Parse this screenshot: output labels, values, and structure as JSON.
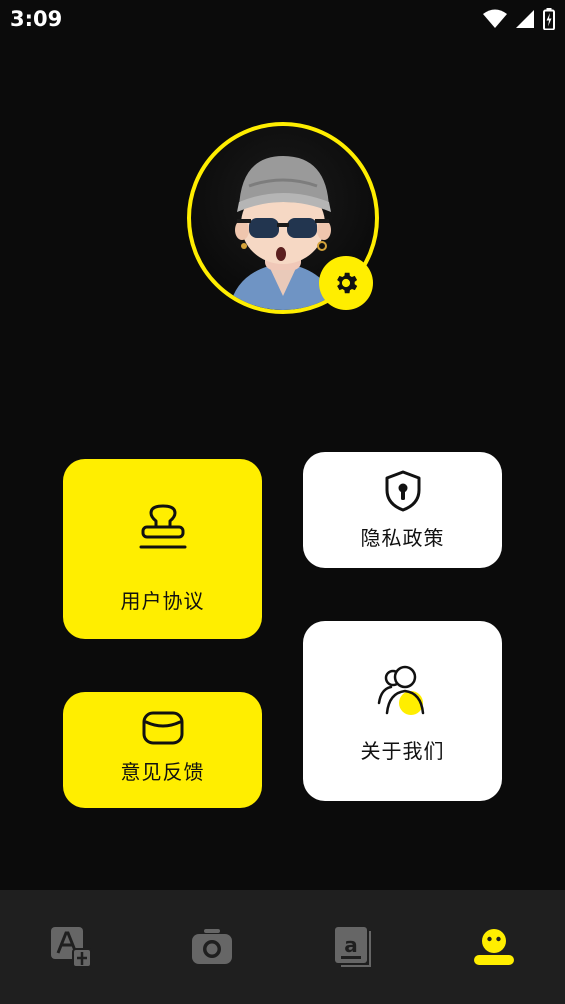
{
  "status_bar": {
    "time": "3:09",
    "icons": [
      "wifi-icon",
      "cellular-signal-icon",
      "battery-icon"
    ]
  },
  "profile": {
    "avatar": "3d-character-avatar",
    "ring_color": "#ffee00",
    "settings_icon": "gear-icon"
  },
  "cards": {
    "agreement": {
      "label": "用户协议",
      "icon": "stamp-icon"
    },
    "privacy": {
      "label": "隐私政策",
      "icon": "shield-lock-icon"
    },
    "feedback": {
      "label": "意见反馈",
      "icon": "mail-icon"
    },
    "about": {
      "label": "关于我们",
      "icon": "users-icon"
    }
  },
  "bottom_nav": {
    "items": [
      {
        "icon": "translate-icon",
        "active": false
      },
      {
        "icon": "camera-icon",
        "active": false
      },
      {
        "icon": "book-icon",
        "active": false
      },
      {
        "icon": "profile-face-icon",
        "active": true
      }
    ]
  },
  "colors": {
    "accent": "#ffee00",
    "background": "#0b0b0b",
    "nav_background": "#1f1f1f",
    "inactive_icon": "#666666"
  }
}
